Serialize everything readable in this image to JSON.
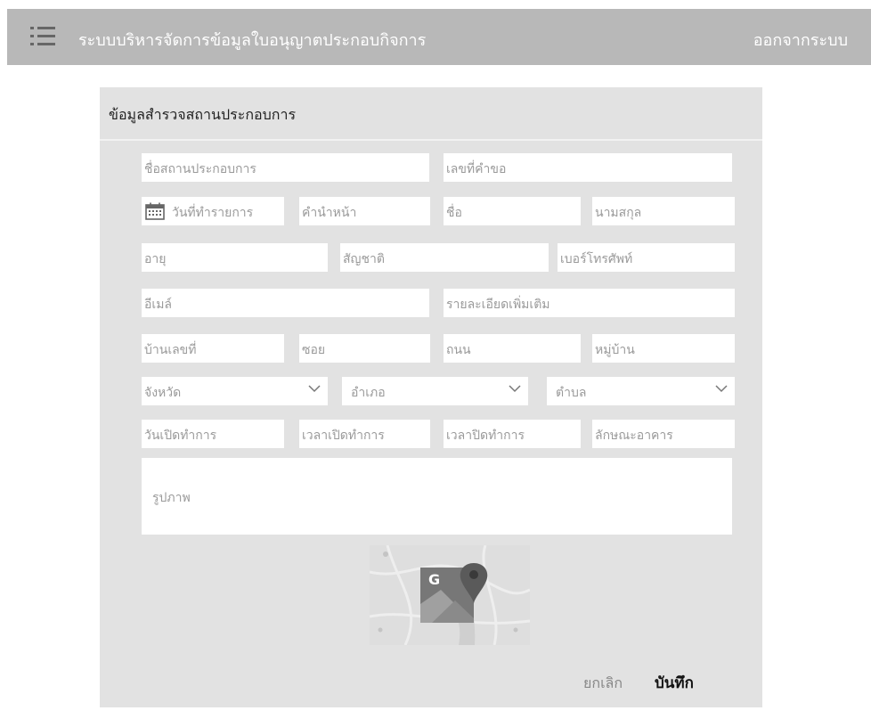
{
  "header": {
    "title": "ระบบบริหารจัดการข้อมูลใบอนุญาตประกอบกิจการ",
    "logout_label": "ออกจากระบบ",
    "menu_icon": "hamburger-menu-icon"
  },
  "form": {
    "title": "ข้อมูลสำรวจสถานประกอบการ",
    "fields": {
      "business_name": "ชื่อสถานประกอบการ",
      "request_no": "เลขที่คำขอ",
      "transaction_date": "วันที่ทำรายการ",
      "prefix": "คำนำหน้า",
      "first_name": "ชื่อ",
      "last_name": "นามสกุล",
      "age": "อายุ",
      "nationality": "สัญชาติ",
      "phone": "เบอร์โทรศัพท์",
      "email": "อีเมล์",
      "details": "รายละเอียดเพิ่มเติม",
      "house_no": "บ้านเลขที่",
      "soi": "ซอย",
      "road": "ถนน",
      "village": "หมู่บ้าน",
      "province": "จังหวัด",
      "district": "อำเภอ",
      "subdistrict": "ตำบล",
      "open_day": "วันเปิดทำการ",
      "open_time": "เวลาเปิดทำการ",
      "close_time": "เวลาปิดทำการ",
      "building_type": "ลักษณะอาคาร",
      "photo": "รูปภาพ"
    },
    "map_icon": "google-maps-icon",
    "cancel_label": "ยกเลิก",
    "save_label": "บันทึก"
  }
}
